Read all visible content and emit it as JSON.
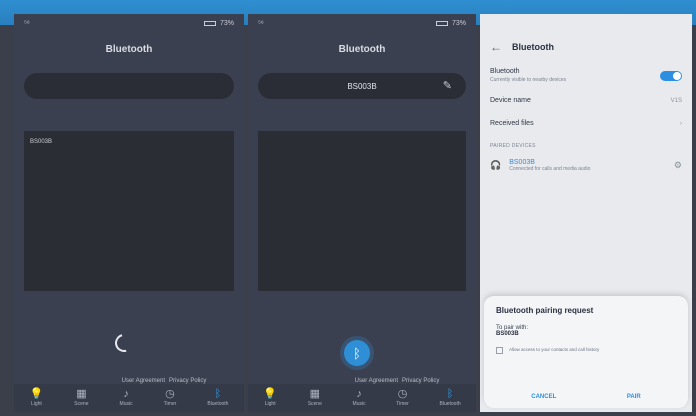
{
  "phone1": {
    "status_left": "⁵⁶",
    "status_right": "73%",
    "title": "Bluetooth",
    "pill_text": "",
    "list_items": [
      "BS003B"
    ],
    "links": {
      "agreement": "User Agreement",
      "privacy": "Privacy Policy"
    },
    "nav": [
      {
        "label": "Light",
        "icon": "bulb-icon"
      },
      {
        "label": "Scene",
        "icon": "grid-icon"
      },
      {
        "label": "Music",
        "icon": "music-icon"
      },
      {
        "label": "Timer",
        "icon": "clock-icon"
      },
      {
        "label": "Bluetooth",
        "icon": "bluetooth-icon"
      }
    ]
  },
  "phone2": {
    "status_left": "⁵⁶",
    "status_right": "73%",
    "title": "Bluetooth",
    "pill_text": "BS003B",
    "list_items": [],
    "links": {
      "agreement": "User Agreement",
      "privacy": "Privacy Policy"
    },
    "nav": [
      {
        "label": "Light",
        "icon": "bulb-icon"
      },
      {
        "label": "Scene",
        "icon": "grid-icon"
      },
      {
        "label": "Music",
        "icon": "music-icon"
      },
      {
        "label": "Timer",
        "icon": "clock-icon"
      },
      {
        "label": "Bluetooth",
        "icon": "bluetooth-icon"
      }
    ]
  },
  "phone3": {
    "header": "Bluetooth",
    "bt_row": {
      "label": "Bluetooth",
      "sub": "Currently visible to nearby devices"
    },
    "device_name": {
      "label": "Device name",
      "value": "V1S"
    },
    "received_files": "Received files",
    "paired_heading": "PAIRED DEVICES",
    "paired_device": {
      "name": "BS003B",
      "sub": "Connected for calls and media audio"
    },
    "dialog": {
      "title": "Bluetooth pairing request",
      "pair_with": "To pair with:",
      "device": "BS003B",
      "checkbox_text": "Allow access to your contacts and call history",
      "cancel": "CANCEL",
      "pair": "PAIR"
    }
  },
  "colors": {
    "accent": "#2d8fe0",
    "dark_bg": "#3b4050",
    "settings_bg": "#e8eaee"
  }
}
